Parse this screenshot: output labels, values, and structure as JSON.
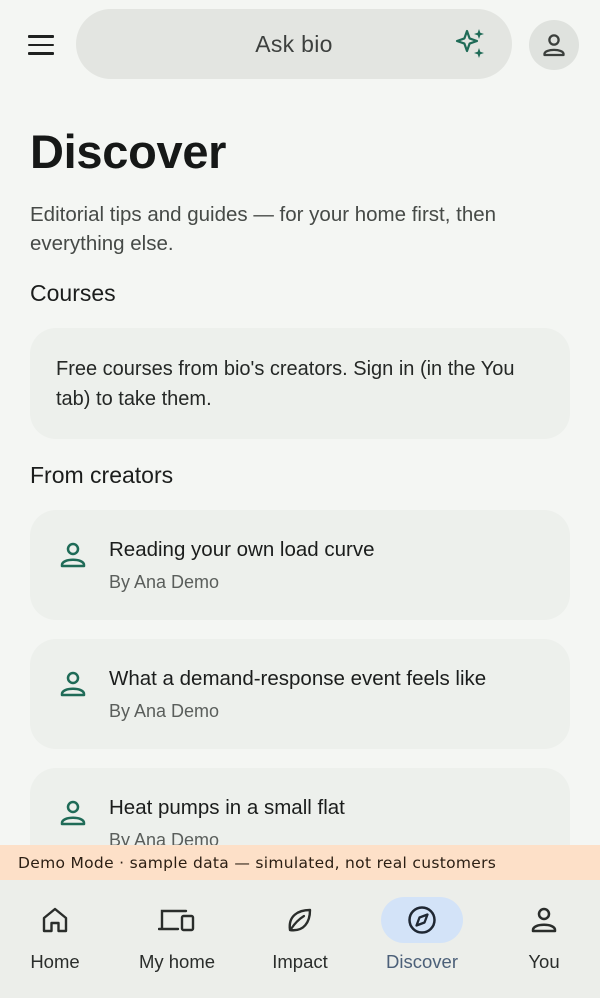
{
  "top_bar": {
    "menu_icon": "menu-icon",
    "search_label": "Ask bio",
    "sparkle_icon": "sparkle-icon",
    "account_icon": "person-icon",
    "accent_color": "#1f6b57"
  },
  "page": {
    "title": "Discover",
    "subtitle": "Editorial tips and guides — for your home first, then everything else."
  },
  "courses": {
    "heading": "Courses",
    "info_text": "Free courses from bio's creators. Sign in (in the You tab) to take them."
  },
  "creators": {
    "heading": "From creators",
    "items": [
      {
        "title": "Reading your own load curve",
        "author": "By Ana Demo",
        "icon": "person-icon"
      },
      {
        "title": "What a demand-response event feels like",
        "author": "By Ana Demo",
        "icon": "person-icon"
      },
      {
        "title": "Heat pumps in a small flat",
        "author": "By Ana Demo",
        "icon": "person-icon"
      }
    ]
  },
  "demo_banner": "Demo Mode · sample data — simulated, not real customers",
  "bottom_nav": {
    "active": "Discover",
    "items": [
      {
        "label": "Home",
        "icon": "home-icon"
      },
      {
        "label": "My home",
        "icon": "devices-icon"
      },
      {
        "label": "Impact",
        "icon": "leaf-icon"
      },
      {
        "label": "Discover",
        "icon": "compass-icon"
      },
      {
        "label": "You",
        "icon": "person-icon"
      }
    ]
  }
}
